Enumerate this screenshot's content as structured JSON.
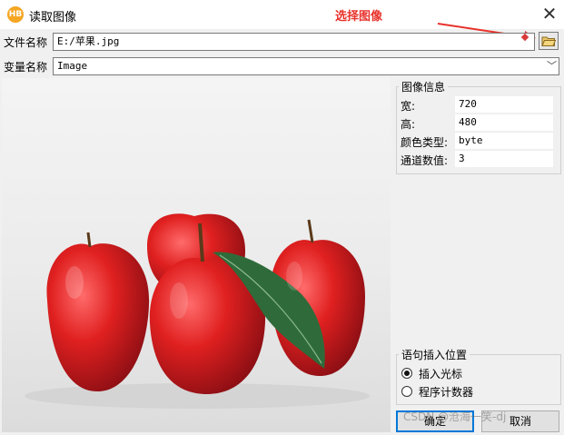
{
  "window": {
    "title": "读取图像",
    "app_icon_text": "HB",
    "close_glyph": "✕"
  },
  "annotation": {
    "text": "选择图像",
    "color": "#e8322b"
  },
  "file_row": {
    "label": "文件名称",
    "value": "E:/苹果.jpg"
  },
  "var_row": {
    "label": "变量名称",
    "value": "Image",
    "dropdown_glyph": "﹀"
  },
  "image_info": {
    "legend": "图像信息",
    "rows": [
      {
        "key": "宽:",
        "value": "720"
      },
      {
        "key": "高:",
        "value": "480"
      },
      {
        "key": "颜色类型:",
        "value": "byte"
      },
      {
        "key": "通道数值:",
        "value": "3"
      }
    ]
  },
  "insert_position": {
    "legend": "语句插入位置",
    "options": [
      {
        "label": "插入光标",
        "selected": true
      },
      {
        "label": "程序计数器",
        "selected": false
      }
    ]
  },
  "buttons": {
    "ok": "确定",
    "cancel": "取消"
  },
  "watermark": "CSDN @沧海一笑-dj"
}
